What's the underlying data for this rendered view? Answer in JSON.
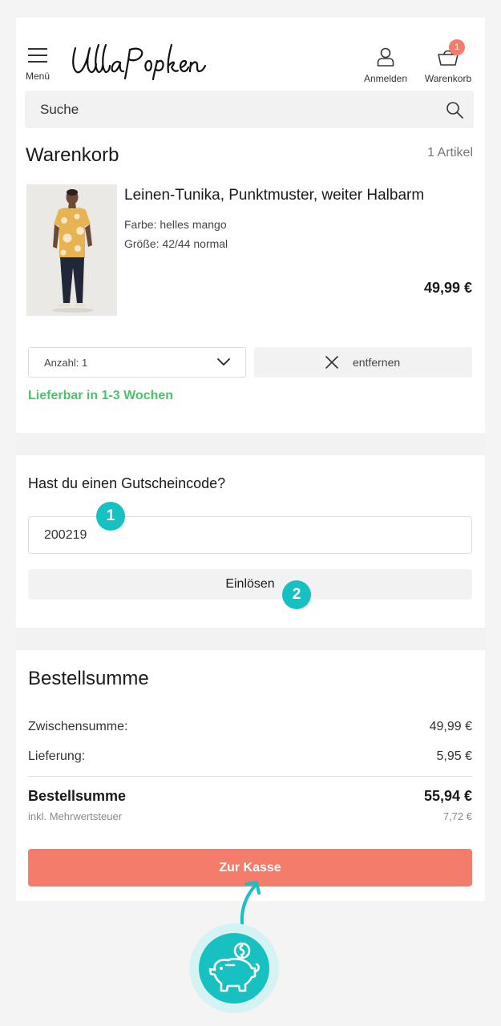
{
  "header": {
    "menu_label": "Menü",
    "brand": "Ulla Popken",
    "login_label": "Anmelden",
    "cart_label": "Warenkorb",
    "cart_count": "1"
  },
  "search": {
    "placeholder": "Suche"
  },
  "cart": {
    "title": "Warenkorb",
    "item_count": "1 Artikel",
    "item": {
      "name": "Leinen-Tunika, Punktmuster, weiter Halbarm",
      "color": "Farbe: helles mango",
      "size": "Größe: 42/44 normal",
      "price": "49,99 €",
      "quantity_label": "Anzahl: 1",
      "remove_label": "entfernen",
      "availability": "Lieferbar in 1-3 Wochen"
    }
  },
  "coupon": {
    "question": "Hast du einen Gutscheincode?",
    "value": "200219",
    "redeem_label": "Einlösen"
  },
  "summary": {
    "title": "Bestellsumme",
    "subtotal_label": "Zwischensumme:",
    "subtotal_value": "49,99 €",
    "shipping_label": "Lieferung:",
    "shipping_value": "5,95 €",
    "total_label": "Bestellsumme",
    "total_value": "55,94 €",
    "vat_label": "inkl. Mehrwertsteuer",
    "vat_value": "7,72 €",
    "checkout_label": "Zur Kasse"
  },
  "annotations": {
    "step1": "1",
    "step2": "2"
  },
  "colors": {
    "accent": "#f47c6a",
    "teal": "#18c1c1",
    "success": "#4cc26e",
    "panel": "#f2f2f2"
  },
  "icons": [
    "menu-icon",
    "user-icon",
    "basket-icon",
    "search-icon",
    "chevron-down-icon",
    "close-icon",
    "arrow-up-icon",
    "piggy-bank-icon"
  ]
}
